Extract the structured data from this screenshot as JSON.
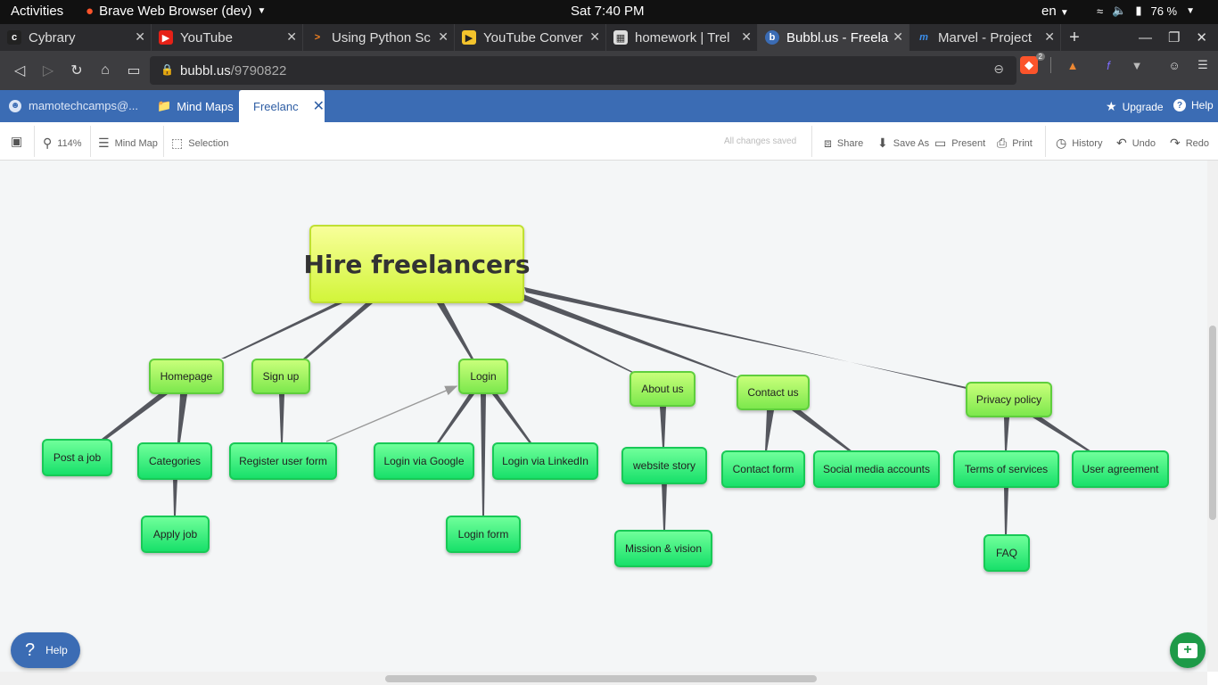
{
  "system_bar": {
    "activities": "Activities",
    "app_name": "Brave Web Browser (dev)",
    "clock": "Sat  7:40 PM",
    "language": "en",
    "battery": "76 %"
  },
  "browser": {
    "tabs": [
      {
        "title": "Cybrary",
        "favicon": "cybrary-icon"
      },
      {
        "title": "YouTube",
        "favicon": "youtube-icon"
      },
      {
        "title": "Using Python Sc",
        "favicon": "terminal-icon"
      },
      {
        "title": "YouTube Conver",
        "favicon": "video-icon"
      },
      {
        "title": "homework | Trel",
        "favicon": "trello-icon"
      },
      {
        "title": "Bubbl.us - Freela",
        "favicon": "bubbl-icon"
      },
      {
        "title": "Marvel - Project",
        "favicon": "marvel-icon"
      }
    ],
    "active_tab": 5,
    "url_domain": "bubbl.us",
    "url_path": "/9790822",
    "brave_badge": "2"
  },
  "app_header": {
    "account": "mamotechcamps@...",
    "mind_maps": "Mind Maps",
    "document_tab": "Freelanc",
    "upgrade": "Upgrade",
    "help": "Help"
  },
  "toolbar": {
    "zoom": "114%",
    "mind_map": "Mind Map",
    "selection": "Selection",
    "status": "All changes saved",
    "share": "Share",
    "save_as": "Save As",
    "present": "Present",
    "print": "Print",
    "history": "History",
    "undo": "Undo",
    "redo": "Redo"
  },
  "mindmap": {
    "root": "Hire freelancers",
    "nodes": {
      "homepage": "Homepage",
      "signup": "Sign up",
      "login": "Login",
      "about": "About us",
      "contact": "Contact us",
      "privacy": "Privacy policy",
      "post_job": "Post a job",
      "categories": "Categories",
      "apply_job": "Apply job",
      "register": "Register user form",
      "login_google": "Login via Google",
      "login_linkedin": "Login via LinkedIn",
      "login_form": "Login form",
      "website_story": "website story",
      "mission": "Mission & vision",
      "contact_form": "Contact form",
      "social": "Social media accounts",
      "terms": "Terms of services",
      "user_agreement": "User agreement",
      "faq": "FAQ"
    }
  },
  "help_button": "Help"
}
